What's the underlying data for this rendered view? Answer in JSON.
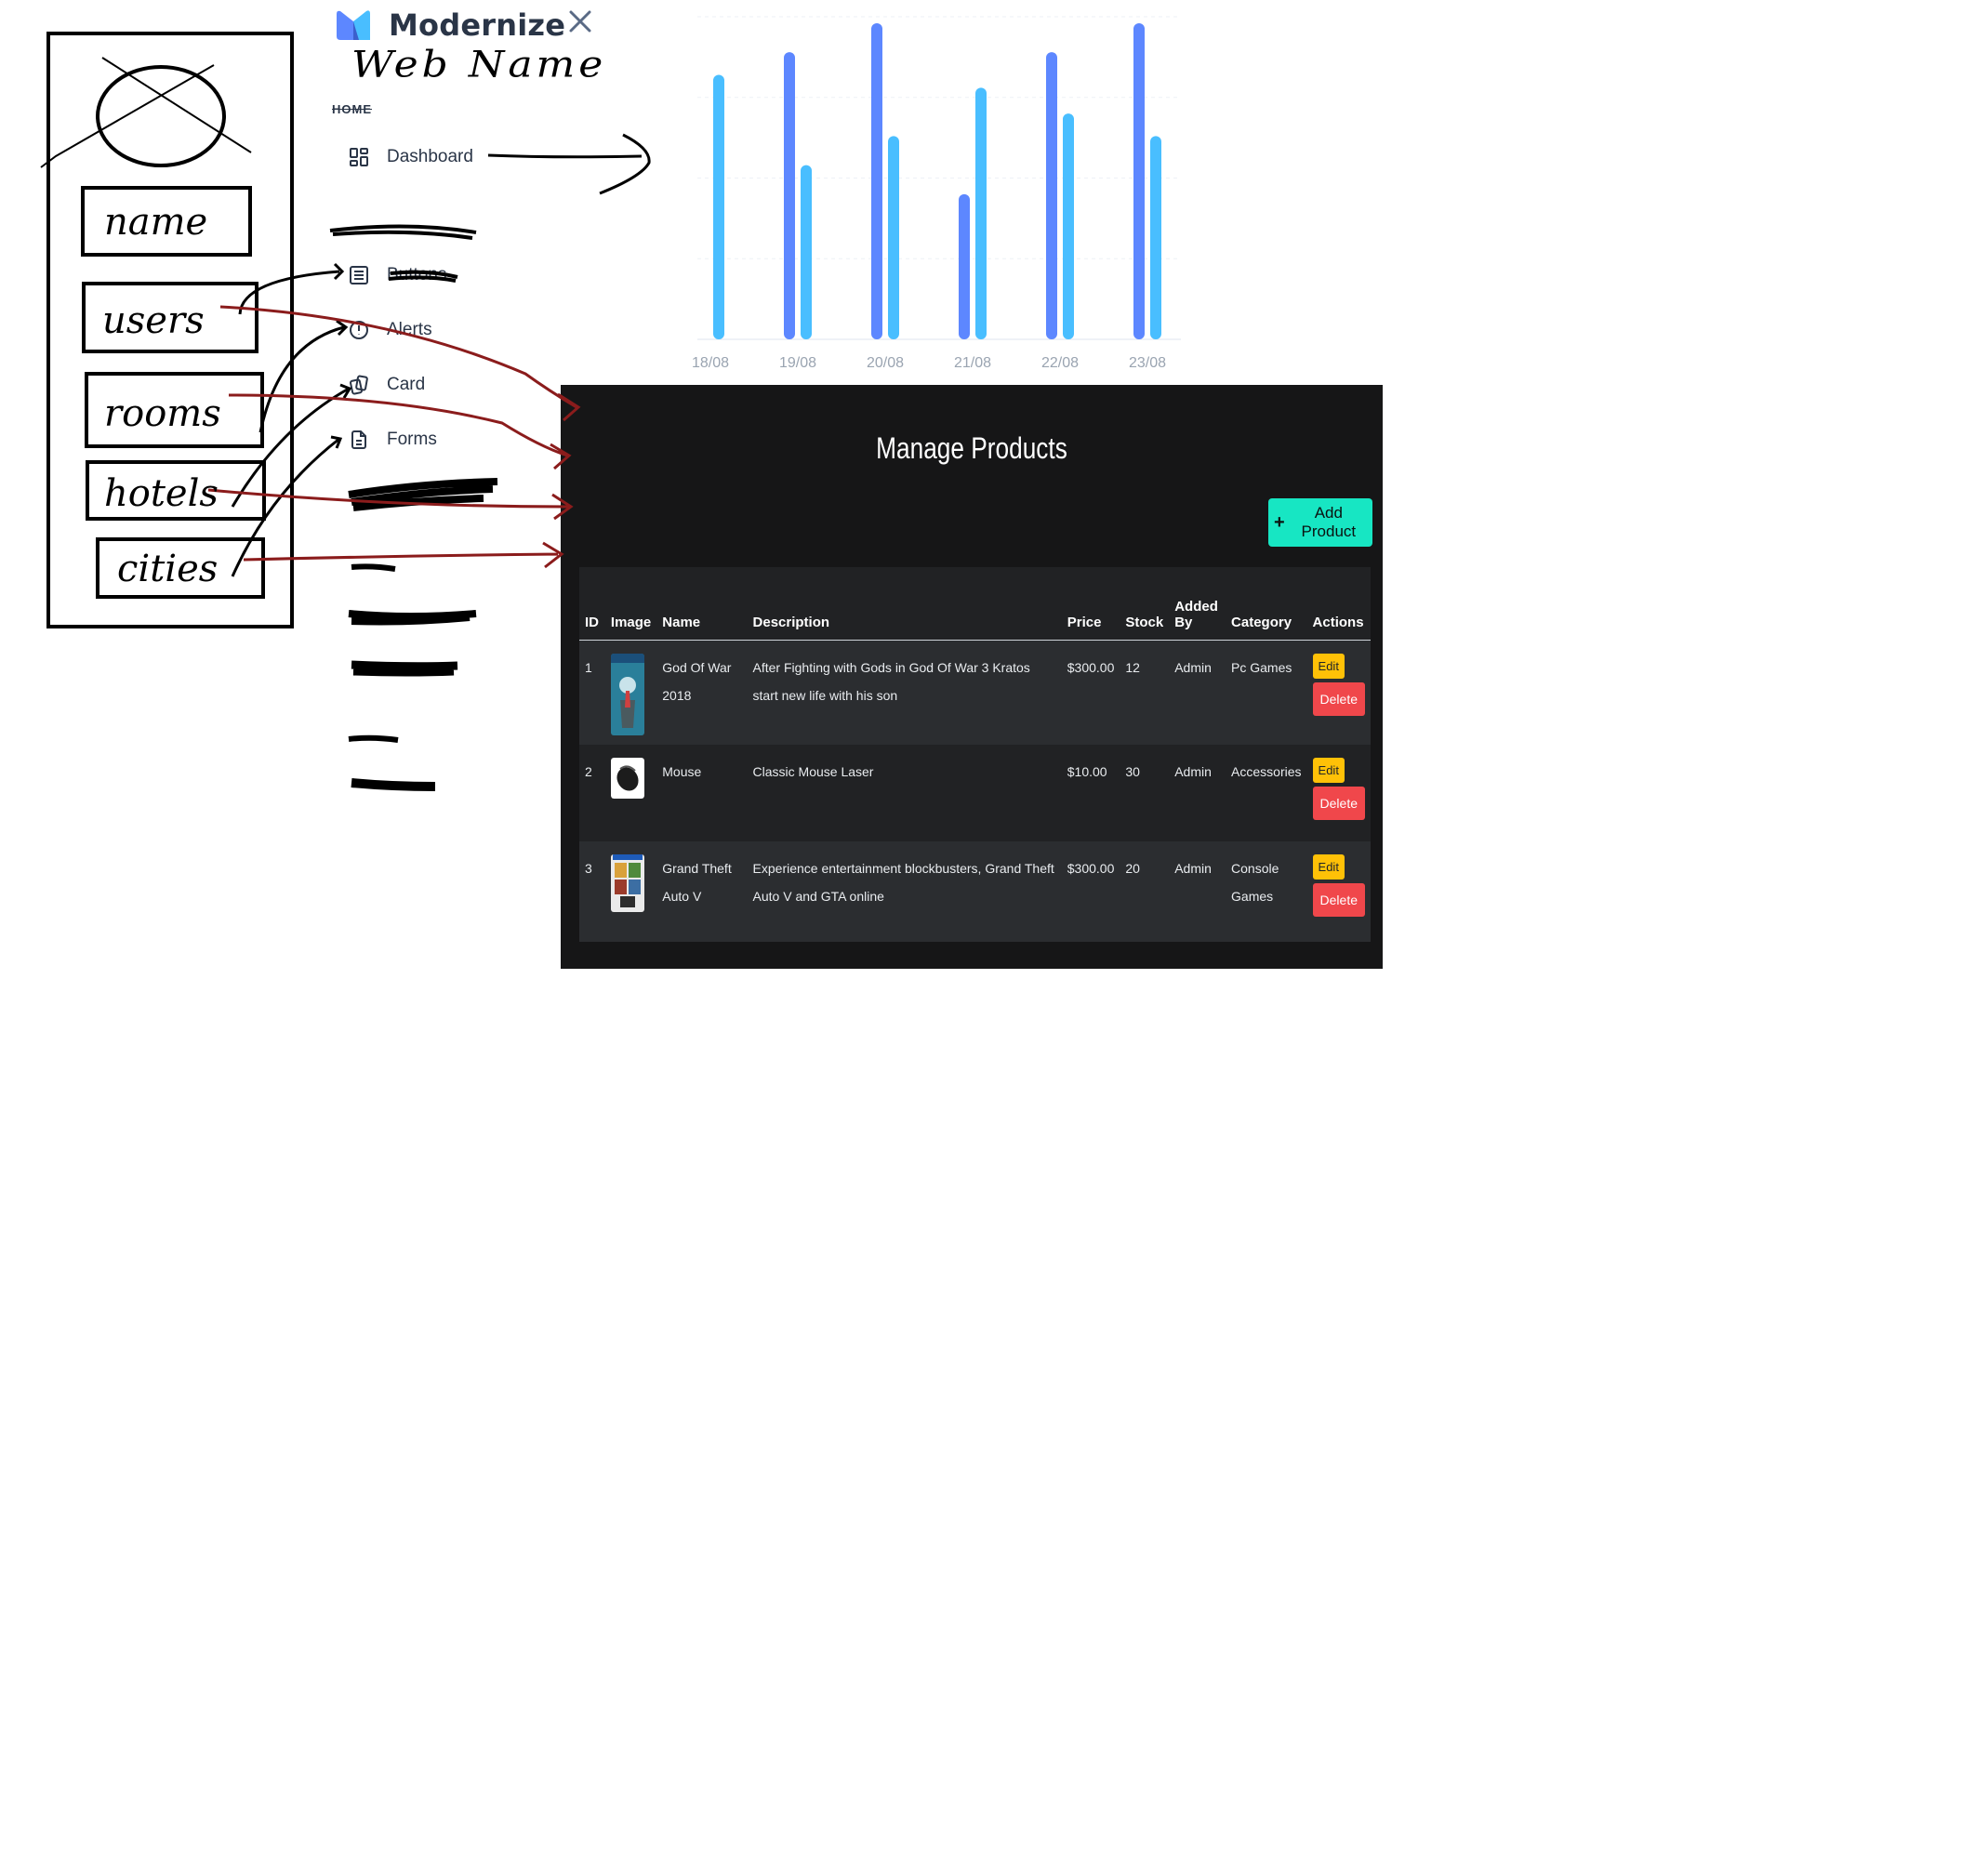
{
  "brand": {
    "name": "Modernize",
    "handwritten_title": "Web Name"
  },
  "nav": {
    "section_home": "HOME",
    "items": [
      {
        "label": "Dashboard",
        "icon": "dashboard-icon"
      },
      {
        "label": "Buttons",
        "icon": "list-icon"
      },
      {
        "label": "Alerts",
        "icon": "alert-circle-icon"
      },
      {
        "label": "Card",
        "icon": "cards-icon"
      },
      {
        "label": "Forms",
        "icon": "file-text-icon"
      }
    ]
  },
  "wireframe": {
    "boxes": [
      "name",
      "users",
      "rooms",
      "hotels",
      "cities"
    ]
  },
  "chart_data": {
    "type": "bar",
    "categories": [
      "18/08",
      "19/08",
      "20/08",
      "21/08",
      "22/08",
      "23/08"
    ],
    "series": [
      {
        "values": [
          null,
          0.89,
          0.98,
          0.45,
          0.89,
          0.98
        ]
      },
      {
        "values": [
          0.82,
          0.54,
          0.63,
          0.78,
          0.7,
          0.63
        ]
      }
    ],
    "ylim": [
      0,
      1
    ],
    "grid": true,
    "colors": [
      "#5d87ff",
      "#49beff"
    ]
  },
  "products": {
    "title": "Manage Products",
    "add_label": "Add Product",
    "headers": {
      "id": "ID",
      "image": "Image",
      "name": "Name",
      "description": "Description",
      "price": "Price",
      "stock": "Stock",
      "added_by": "Added By",
      "category": "Category",
      "actions": "Actions"
    },
    "edit_label": "Edit",
    "delete_label": "Delete",
    "rows": [
      {
        "id": "1",
        "name": "God Of War 2018",
        "description": "After Fighting with Gods in God Of War 3 Kratos start new life with his son",
        "price": "$300.00",
        "stock": "12",
        "added_by": "Admin",
        "category": "Pc Games"
      },
      {
        "id": "2",
        "name": "Mouse",
        "description": "Classic Mouse Laser",
        "price": "$10.00",
        "stock": "30",
        "added_by": "Admin",
        "category": "Accessories"
      },
      {
        "id": "3",
        "name": "Grand Theft Auto V",
        "description": "Experience entertainment blockbusters, Grand Theft Auto V and GTA online",
        "price": "$300.00",
        "stock": "20",
        "added_by": "Admin",
        "category": "Console Games"
      }
    ]
  },
  "colors": {
    "teal": "#17e6c3",
    "edit": "#ffc107",
    "delete": "#f0474b",
    "panel": "#161617"
  }
}
